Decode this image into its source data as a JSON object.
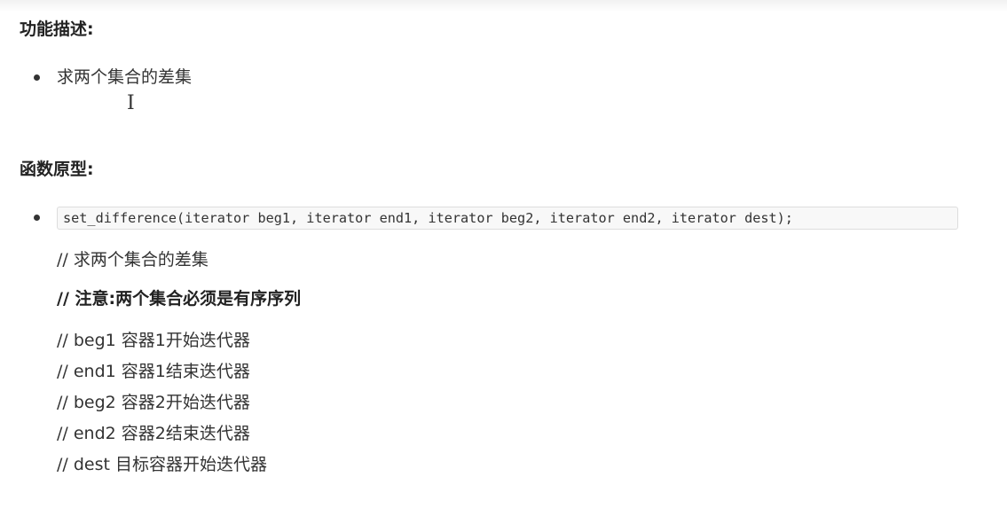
{
  "sections": {
    "description": {
      "heading": "功能描述:",
      "items": [
        "求两个集合的差集"
      ]
    },
    "prototype": {
      "heading": "函数原型:",
      "code": "set_difference(iterator beg1, iterator end1, iterator beg2, iterator end2, iterator dest);",
      "comments": [
        "// 求两个集合的差集",
        "// 注意:两个集合必须是有序序列",
        "// beg1 容器1开始迭代器",
        "// end1 容器1结束迭代器",
        "// beg2 容器2开始迭代器",
        "// end2 容器2结束迭代器",
        "// dest 目标容器开始迭代器"
      ]
    }
  },
  "cursor": {
    "icon": "text-cursor-icon",
    "glyph": "I"
  }
}
